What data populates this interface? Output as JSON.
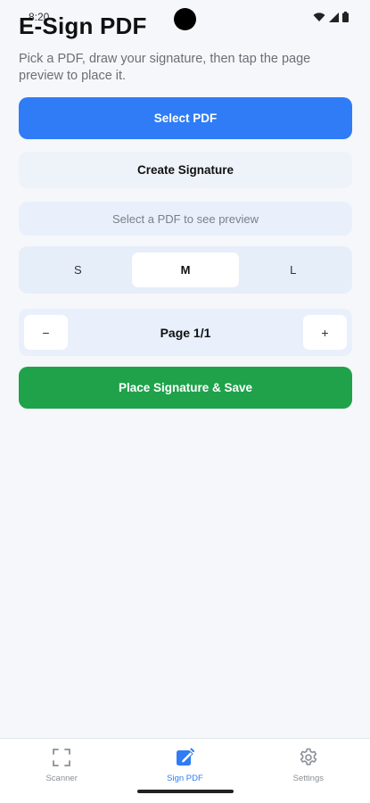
{
  "status": {
    "time": "8:20"
  },
  "header": {
    "title": "E-Sign PDF",
    "subtitle": "Pick a PDF, draw your signature, then tap the page preview to place it."
  },
  "actions": {
    "select_pdf": "Select PDF",
    "create_signature": "Create Signature",
    "place_save": "Place Signature & Save"
  },
  "preview": {
    "placeholder": "Select a PDF to see preview"
  },
  "size": {
    "options": [
      "S",
      "M",
      "L"
    ],
    "selected": "M"
  },
  "pager": {
    "prev": "−",
    "label": "Page 1/1",
    "next": "+"
  },
  "nav": {
    "items": [
      {
        "label": "Scanner",
        "icon": "scanner-icon",
        "active": false
      },
      {
        "label": "Sign PDF",
        "icon": "sign-pdf-icon",
        "active": true
      },
      {
        "label": "Settings",
        "icon": "gear-icon",
        "active": false
      }
    ]
  },
  "colors": {
    "primary": "#2f7cf6",
    "success": "#1fa24a",
    "background": "#f5f7fa"
  }
}
